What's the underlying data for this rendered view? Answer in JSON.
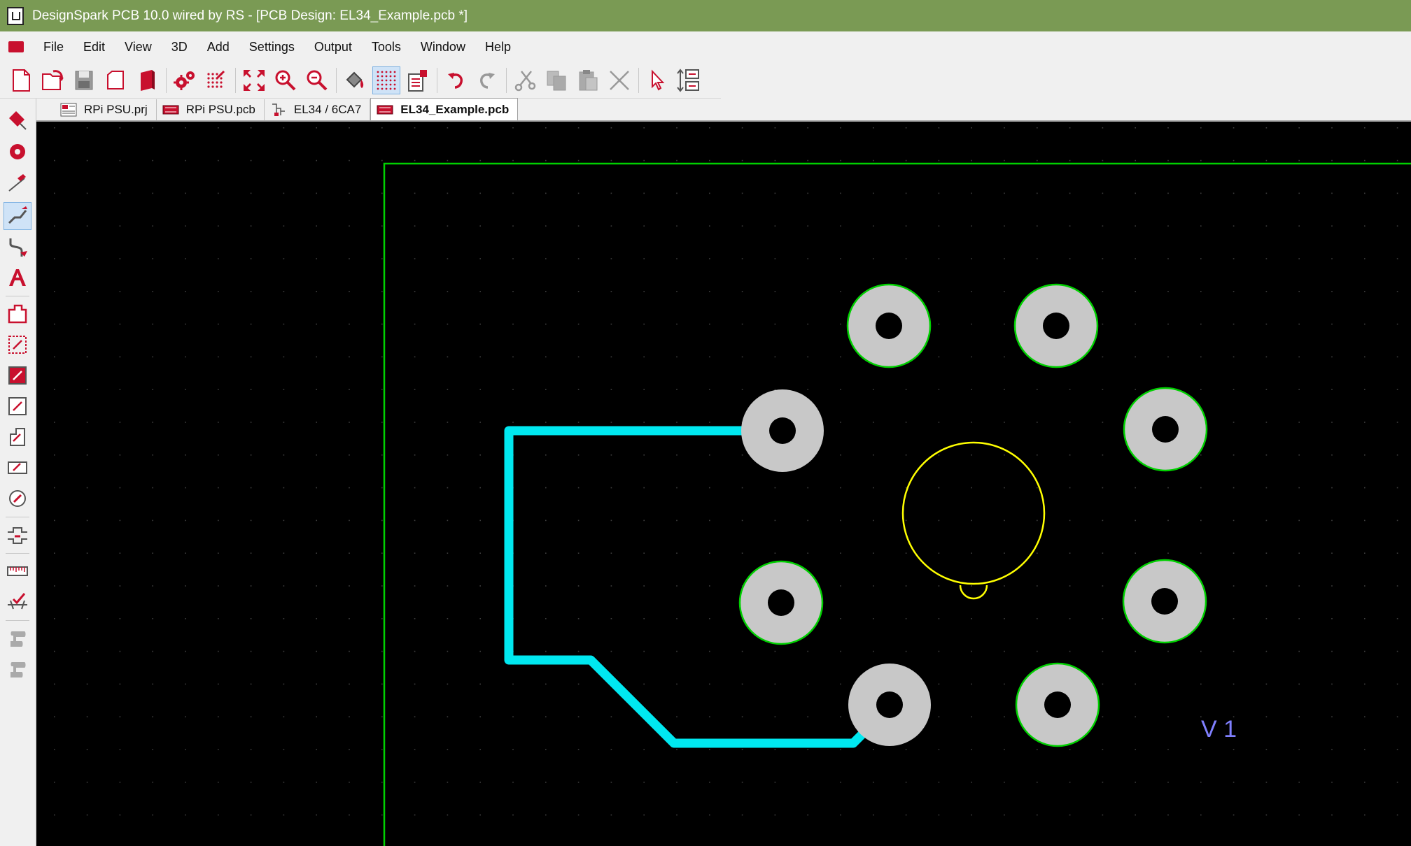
{
  "window": {
    "title": "DesignSpark PCB 10.0 wired by RS - [PCB Design: EL34_Example.pcb *]"
  },
  "menu": {
    "items": [
      "File",
      "Edit",
      "View",
      "3D",
      "Add",
      "Settings",
      "Output",
      "Tools",
      "Window",
      "Help"
    ]
  },
  "toolbar": {
    "buttons": [
      "new-file",
      "open-file",
      "save",
      "open-folder",
      "library",
      "component-settings",
      "grid-settings",
      "zoom-fit",
      "zoom-in",
      "zoom-out",
      "fill-color",
      "grid-toggle",
      "properties",
      "undo",
      "redo",
      "cut",
      "copy",
      "paste",
      "delete",
      "select-pointer",
      "interaction-manager"
    ],
    "active": "grid-toggle"
  },
  "tabs": [
    {
      "label": "RPi PSU.prj",
      "icon": "project-icon"
    },
    {
      "label": "RPi PSU.pcb",
      "icon": "pcb-icon"
    },
    {
      "label": "EL34 / 6CA7",
      "icon": "component-icon"
    },
    {
      "label": "EL34_Example.pcb",
      "icon": "pcb-icon",
      "active": true
    }
  ],
  "sidebar": {
    "tools": [
      "add-component",
      "add-pad",
      "add-shape",
      "add-track",
      "add-curved-track",
      "add-text",
      "board-outline",
      "add-area",
      "add-copper-pour",
      "add-keepout",
      "add-template",
      "add-doc-symbol",
      "add-via",
      "add-jumper",
      "measure",
      "design-check",
      "assistant-1",
      "assistant-2"
    ],
    "active": "add-track"
  },
  "pcb": {
    "component_label": "V 1",
    "colors": {
      "background": "#000000",
      "grid": "#3f3f3f",
      "outline": "#00d000",
      "track": "#00e8f0",
      "pad": "#c8c8c8",
      "pad_outline": "#00d000",
      "silkscreen": "#ffff00",
      "label": "#8080ff"
    }
  }
}
